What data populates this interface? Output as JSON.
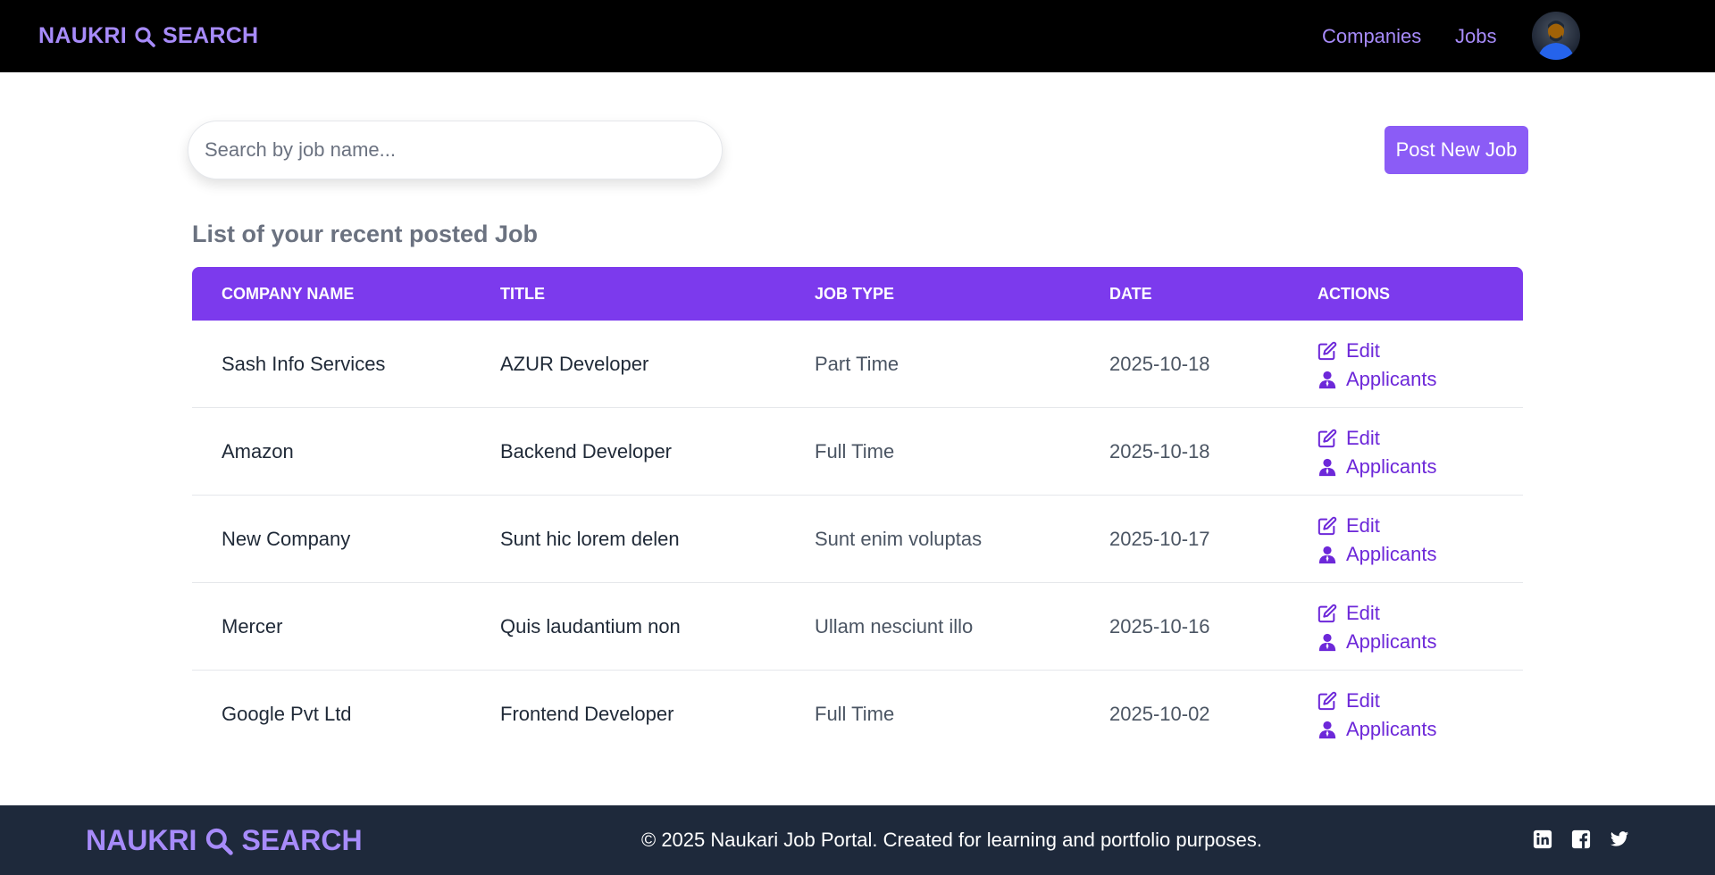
{
  "header": {
    "brand_left": "NAUKRI",
    "brand_right": "SEARCH",
    "nav": {
      "companies": "Companies",
      "jobs": "Jobs"
    }
  },
  "search": {
    "placeholder": "Search by job name..."
  },
  "post_button": "Post New Job",
  "list_title": "List of your recent posted Job",
  "table": {
    "headers": [
      "COMPANY NAME",
      "TITLE",
      "JOB TYPE",
      "DATE",
      "ACTIONS"
    ],
    "rows": [
      {
        "company": "Sash Info Services",
        "title": "AZUR Developer",
        "job_type": "Part Time",
        "date": "2025-10-18"
      },
      {
        "company": "Amazon",
        "title": "Backend Developer",
        "job_type": "Full Time",
        "date": "2025-10-18"
      },
      {
        "company": "New Company",
        "title": "Sunt hic lorem delen",
        "job_type": "Sunt enim voluptas",
        "date": "2025-10-17"
      },
      {
        "company": "Mercer",
        "title": "Quis laudantium non",
        "job_type": "Ullam nesciunt illo",
        "date": "2025-10-16"
      },
      {
        "company": "Google Pvt Ltd",
        "title": "Frontend Developer",
        "job_type": "Full Time",
        "date": "2025-10-02"
      }
    ],
    "actions": {
      "edit": "Edit",
      "applicants": "Applicants"
    }
  },
  "footer": {
    "brand_left": "NAUKRI",
    "brand_right": "SEARCH",
    "copyright": "© 2025 Naukari Job Portal. Created for learning and portfolio purposes.",
    "social_icons": [
      "linkedin-icon",
      "facebook-icon",
      "twitter-icon"
    ]
  },
  "colors": {
    "accent": "#8b5cf6",
    "table_header": "#7c3aed",
    "brand": "#a78bfa",
    "footer_bg": "#1e293b",
    "action_link": "#6d28d9"
  }
}
